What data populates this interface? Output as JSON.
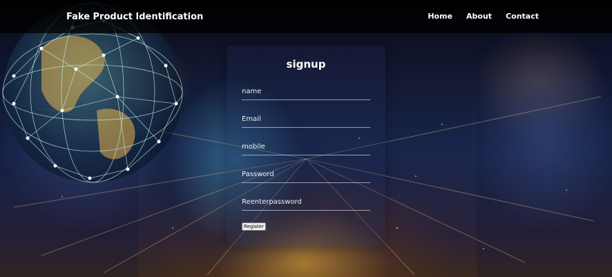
{
  "nav": {
    "brand": "Fake Product Identification",
    "links": [
      {
        "label": "Home"
      },
      {
        "label": "About"
      },
      {
        "label": "Contact"
      }
    ]
  },
  "form": {
    "title": "signup",
    "fields": [
      {
        "placeholder": "name",
        "value": ""
      },
      {
        "placeholder": "Email",
        "value": ""
      },
      {
        "placeholder": "mobile",
        "value": ""
      },
      {
        "placeholder": "Password",
        "value": ""
      },
      {
        "placeholder": "Reenterpassword",
        "value": ""
      }
    ],
    "submit_label": "Register"
  },
  "colors": {
    "nav_bg": "#000000",
    "text": "#ffffff",
    "globe_lines": "#bdf2e6",
    "globe_land": "#e6b34a"
  },
  "icons": [
    "network-globe-image"
  ]
}
